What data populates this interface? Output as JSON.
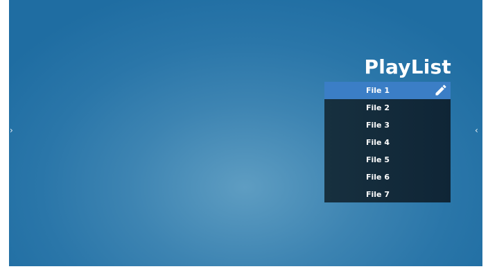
{
  "navigation": {
    "left_arrow": "›",
    "right_arrow": "‹"
  },
  "playlist": {
    "title": "PlayList",
    "items": [
      {
        "label": "File 1",
        "selected": true
      },
      {
        "label": "File 2",
        "selected": false
      },
      {
        "label": "File 3",
        "selected": false
      },
      {
        "label": "File 4",
        "selected": false
      },
      {
        "label": "File 5",
        "selected": false
      },
      {
        "label": "File 6",
        "selected": false
      },
      {
        "label": "File 7",
        "selected": false
      }
    ],
    "edit_icon": "pencil-icon"
  },
  "colors": {
    "background_accent": "#2a76a9",
    "selected_item": "#3b7ec6",
    "list_background": "#17303f",
    "text": "#ffffff"
  }
}
